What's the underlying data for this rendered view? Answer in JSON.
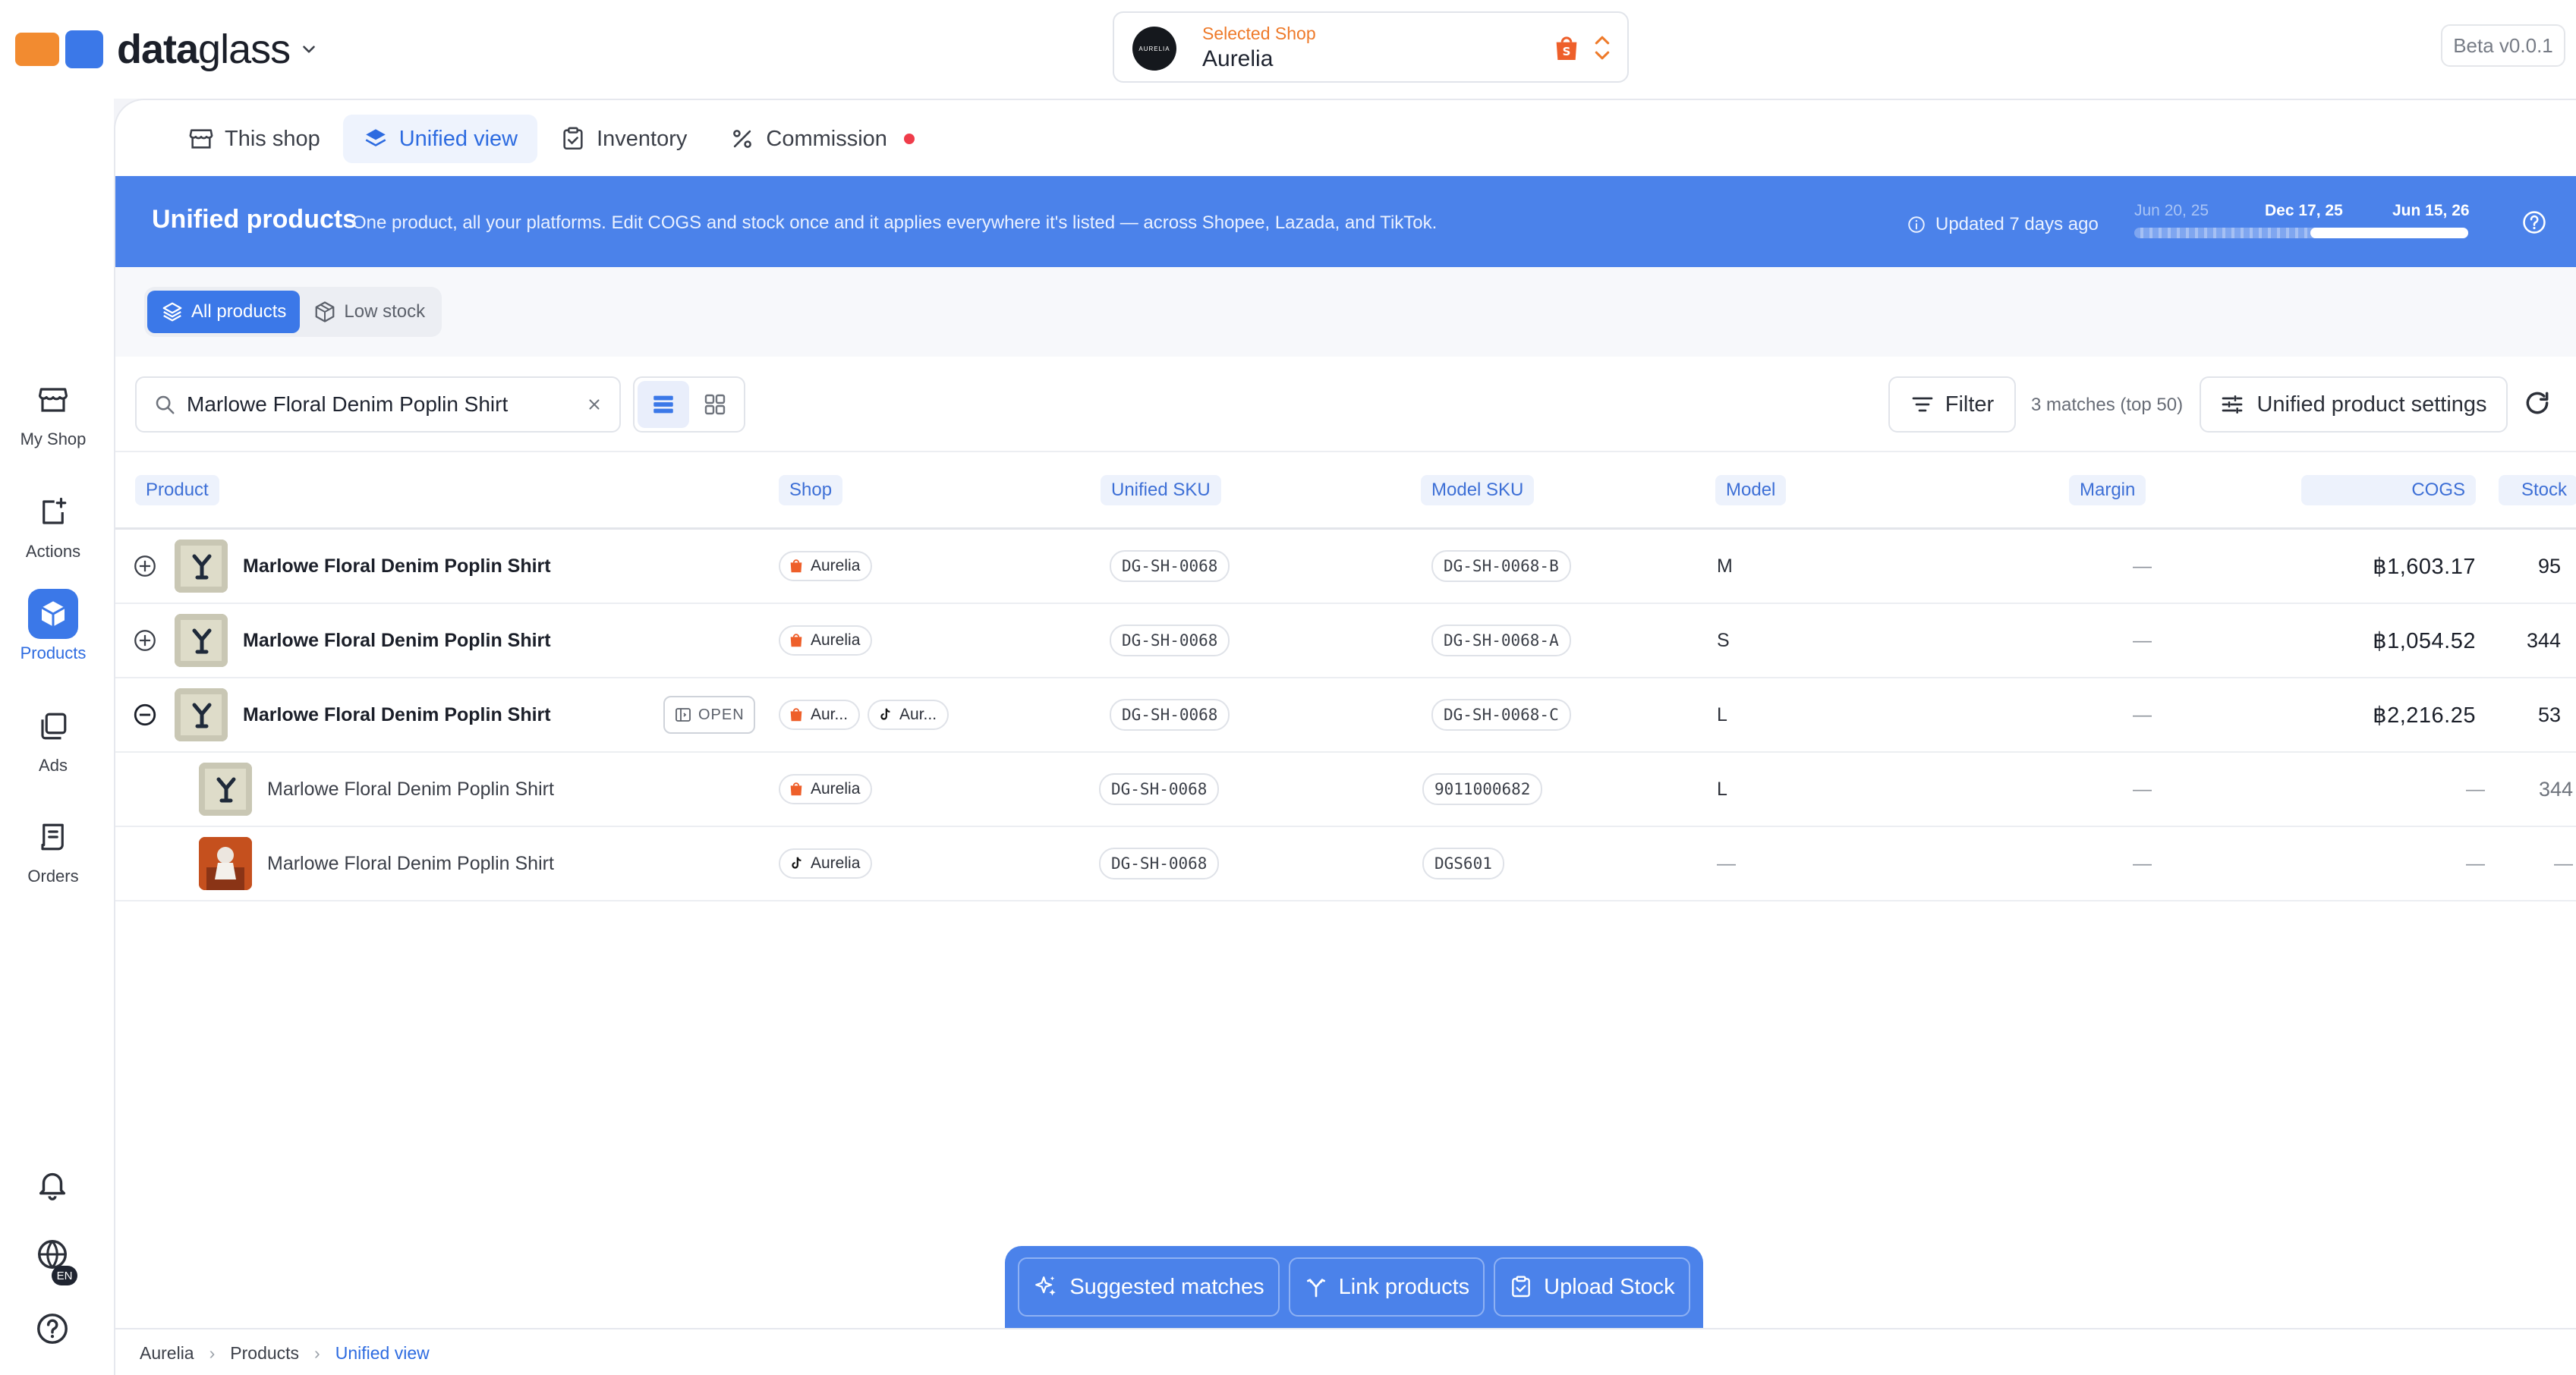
{
  "app": {
    "brand_bold": "data",
    "brand_light": "glass",
    "beta": "Beta v0.0.1"
  },
  "shop_selector": {
    "caption": "Selected Shop",
    "name": "Aurelia",
    "avatar_text": "AURELIA"
  },
  "sidebar": {
    "items": [
      {
        "label": "My Shop",
        "icon": "store-icon"
      },
      {
        "label": "Actions",
        "icon": "actions-icon"
      },
      {
        "label": "Products",
        "icon": "box-icon",
        "active": true
      },
      {
        "label": "Ads",
        "icon": "ads-icon"
      },
      {
        "label": "Orders",
        "icon": "orders-icon"
      }
    ],
    "bottom": {
      "language": "EN"
    }
  },
  "tabs": [
    {
      "label": "This shop"
    },
    {
      "label": "Unified view",
      "active": true
    },
    {
      "label": "Inventory"
    },
    {
      "label": "Commission"
    }
  ],
  "banner": {
    "title": "Unified products",
    "description": "One product, all your platforms. Edit COGS and stock once and it applies everywhere it's listed — across Shopee, Lazada, and TikTok.",
    "updated": "Updated 7 days ago",
    "range": {
      "start": "Jun 20, 25",
      "mid": "Dec 17, 25",
      "end": "Jun 15, 26"
    }
  },
  "subtabs": [
    {
      "label": "All products",
      "active": true
    },
    {
      "label": "Low stock"
    }
  ],
  "toolbar": {
    "search_value": "Marlowe Floral Denim Poplin Shirt",
    "filter_label": "Filter",
    "matches": "3 matches (top 50)",
    "settings_label": "Unified product settings"
  },
  "table": {
    "columns": [
      "Product",
      "Shop",
      "Unified SKU",
      "Model SKU",
      "Model",
      "Margin",
      "COGS",
      "Stock"
    ],
    "rows": [
      {
        "name": "Marlowe Floral Denim Poplin Shirt",
        "shop": "Aurelia",
        "unified_sku": "DG-SH-0068",
        "model_sku": "DG-SH-0068-B",
        "model": "M",
        "margin": "—",
        "cogs": "฿1,603.17",
        "stock": "95"
      },
      {
        "name": "Marlowe Floral Denim Poplin Shirt",
        "shop": "Aurelia",
        "unified_sku": "DG-SH-0068",
        "model_sku": "DG-SH-0068-A",
        "model": "S",
        "margin": "—",
        "cogs": "฿1,054.52",
        "stock": "344"
      },
      {
        "name": "Marlowe Floral Denim Poplin Shirt",
        "open_label": "OPEN",
        "shop": "Aur...",
        "shop2": "Aur...",
        "unified_sku": "DG-SH-0068",
        "model_sku": "DG-SH-0068-C",
        "model": "L",
        "margin": "—",
        "cogs": "฿2,216.25",
        "stock": "53"
      },
      {
        "name": "Marlowe Floral Denim Poplin Shirt",
        "shop": "Aurelia",
        "unified_sku": "DG-SH-0068",
        "model_sku": "9011000682",
        "model": "L",
        "margin": "—",
        "cogs": "—",
        "stock": "344"
      },
      {
        "name": "Marlowe Floral Denim Poplin Shirt",
        "shop": "Aurelia",
        "unified_sku": "DG-SH-0068",
        "model_sku": "DGS601",
        "model": "—",
        "margin": "—",
        "cogs": "—",
        "stock": "—"
      }
    ]
  },
  "actions": {
    "suggested": "Suggested matches",
    "link": "Link products",
    "upload": "Upload Stock"
  },
  "breadcrumb": [
    "Aurelia",
    "Products",
    "Unified view"
  ],
  "colors": {
    "accent": "#4b82ea",
    "shopee": "#ee5f2a",
    "logo_orange": "#f28b30",
    "alert_dot": "#ef3c4a"
  }
}
